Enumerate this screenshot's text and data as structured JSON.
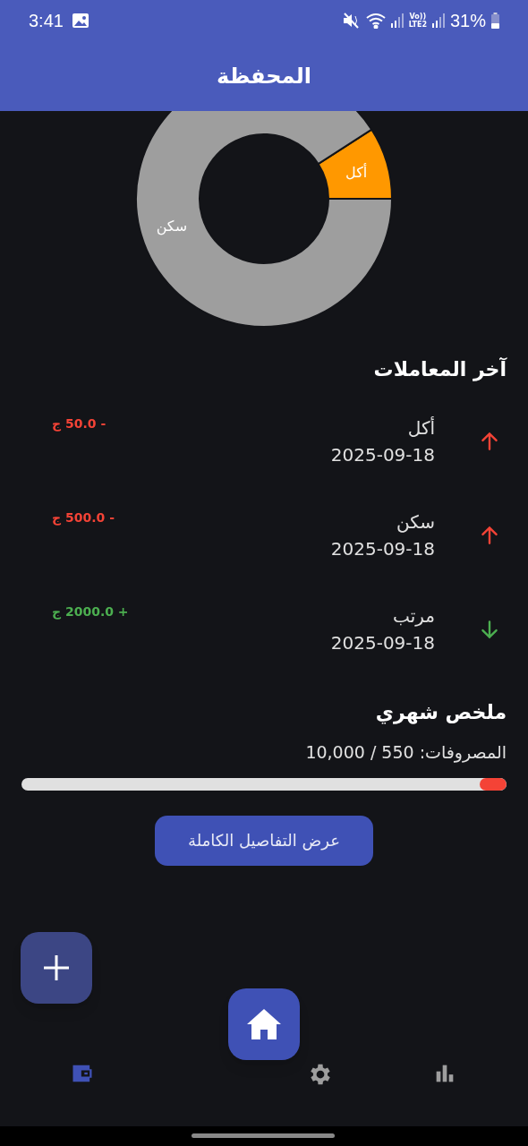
{
  "status_bar": {
    "time": "3:41",
    "network_top": "Vo))",
    "network_bottom": "LTE2",
    "battery": "31%"
  },
  "header": {
    "title": "المحفظة"
  },
  "chart": {
    "chart_data": {
      "type": "donut",
      "categories": [
        "أكل",
        "سكن"
      ],
      "values": [
        9.09,
        90.91
      ],
      "colors": [
        "#ff9800",
        "#9e9e9e"
      ]
    }
  },
  "recent": {
    "title": "آخر المعاملات",
    "transactions": [
      {
        "name": "أكل",
        "date": "2025-09-18",
        "amount": "- 50.0 ج",
        "kind": "expense"
      },
      {
        "name": "سكن",
        "date": "2025-09-18",
        "amount": "- 500.0 ج",
        "kind": "expense"
      },
      {
        "name": "مرتب",
        "date": "2025-09-18",
        "amount": "+ 2000.0 ج",
        "kind": "income"
      }
    ]
  },
  "summary": {
    "title": "ملخص شهري",
    "spent": "المصروفات: 550 / 10,000",
    "level": 0.055,
    "button": "عرض التفاصيل الكاملة"
  },
  "bottom_nav": {
    "items": [
      {
        "kind": "wallet",
        "selected": true
      },
      {
        "kind": "settings",
        "selected": false
      },
      {
        "kind": "stats",
        "selected": false
      }
    ]
  }
}
